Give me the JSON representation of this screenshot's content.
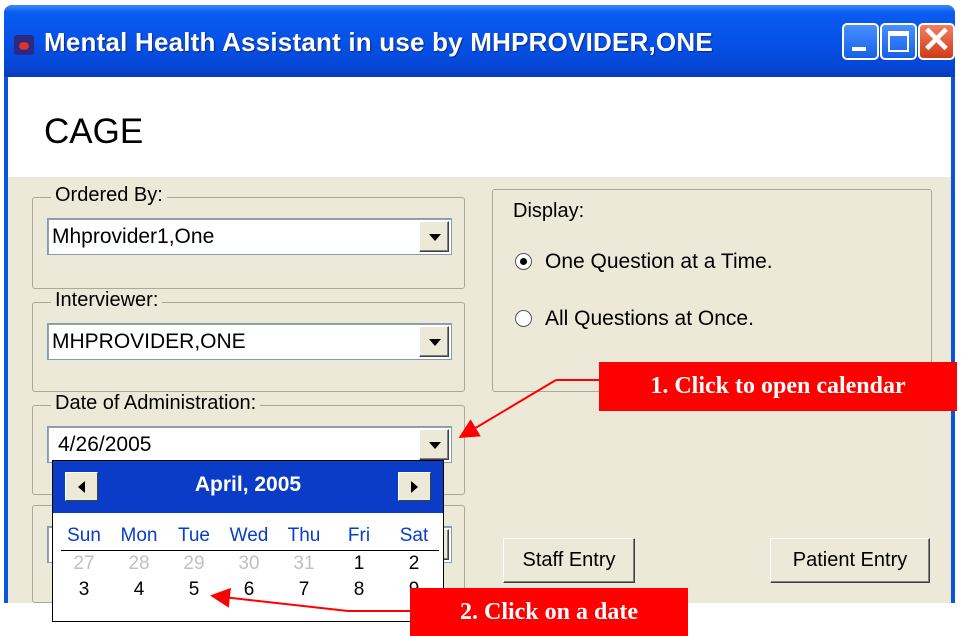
{
  "window": {
    "title": "Mental Health Assistant in use by MHPROVIDER,ONE",
    "close_glyph": "✕"
  },
  "page": {
    "title": "CAGE"
  },
  "ordered_by": {
    "label": "Ordered By:",
    "value": "Mhprovider1,One"
  },
  "interviewer": {
    "label": "Interviewer:",
    "value": "MHPROVIDER,ONE"
  },
  "date_of_administration": {
    "label": "Date of Administration:",
    "value": "4/26/2005"
  },
  "display": {
    "label": "Display:",
    "options": [
      {
        "label": "One Question at a Time.",
        "checked": true
      },
      {
        "label": "All Questions at Once.",
        "checked": false
      }
    ]
  },
  "buttons": {
    "staff_entry": "Staff Entry",
    "patient_entry": "Patient Entry"
  },
  "calendar": {
    "month_label": "April, 2005",
    "weekdays": [
      "Sun",
      "Mon",
      "Tue",
      "Wed",
      "Thu",
      "Fri",
      "Sat"
    ],
    "weeks": [
      [
        {
          "d": "27",
          "muted": true
        },
        {
          "d": "28",
          "muted": true
        },
        {
          "d": "29",
          "muted": true
        },
        {
          "d": "30",
          "muted": true
        },
        {
          "d": "31",
          "muted": true
        },
        {
          "d": "1",
          "muted": false
        },
        {
          "d": "2",
          "muted": false
        }
      ],
      [
        {
          "d": "3",
          "muted": false
        },
        {
          "d": "4",
          "muted": false
        },
        {
          "d": "5",
          "muted": false
        },
        {
          "d": "6",
          "muted": false
        },
        {
          "d": "7",
          "muted": false
        },
        {
          "d": "8",
          "muted": false
        },
        {
          "d": "9",
          "muted": false
        }
      ]
    ]
  },
  "annotations": {
    "callout_1": "1. Click to open calendar",
    "callout_2": "2. Click on a date"
  },
  "colors": {
    "title_bar": "#0a54e0",
    "dialog_bg": "#ece9d8",
    "calendar_header": "#0a3cc8",
    "callout": "#ff0000"
  }
}
